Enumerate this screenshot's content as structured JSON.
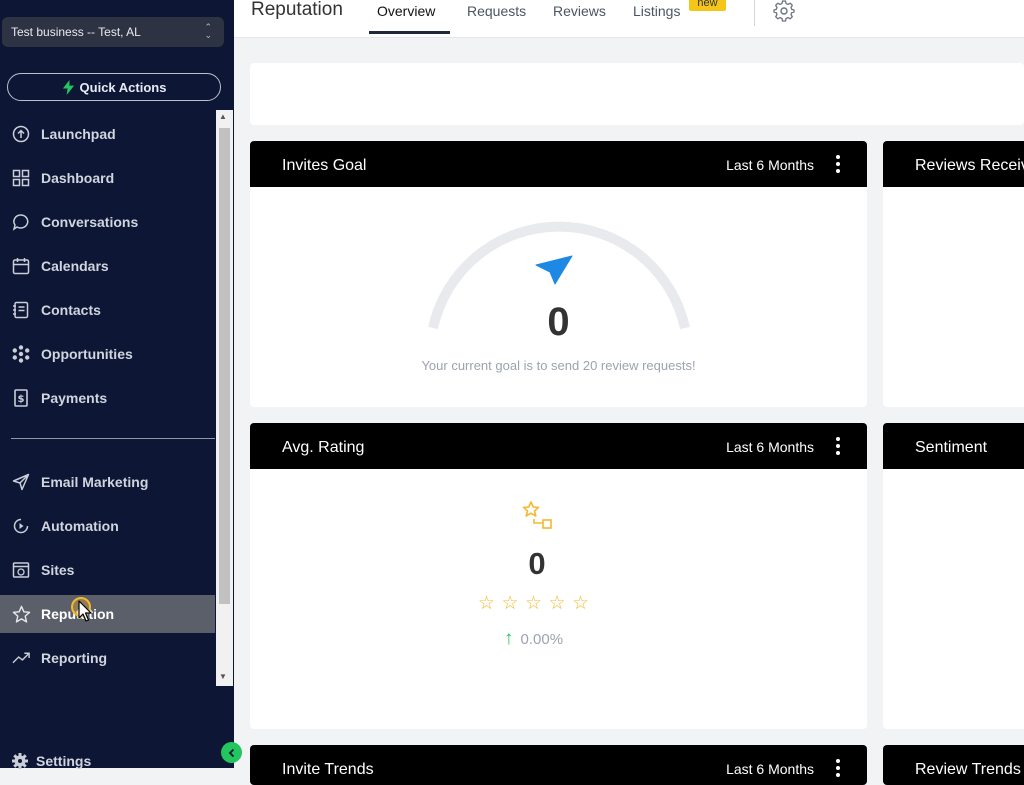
{
  "sidebar": {
    "location": "Test business -- Test, AL",
    "quick_actions": "Quick Actions",
    "items": [
      {
        "label": "Launchpad",
        "icon": "launchpad-icon"
      },
      {
        "label": "Dashboard",
        "icon": "dashboard-icon"
      },
      {
        "label": "Conversations",
        "icon": "chat-icon"
      },
      {
        "label": "Calendars",
        "icon": "calendar-icon"
      },
      {
        "label": "Contacts",
        "icon": "contacts-icon"
      },
      {
        "label": "Opportunities",
        "icon": "opportunities-icon"
      },
      {
        "label": "Payments",
        "icon": "payments-icon"
      },
      {
        "label": "Email Marketing",
        "icon": "send-icon"
      },
      {
        "label": "Automation",
        "icon": "automation-icon"
      },
      {
        "label": "Sites",
        "icon": "sites-icon"
      },
      {
        "label": "Reputation",
        "icon": "star-icon",
        "active": true
      },
      {
        "label": "Reporting",
        "icon": "reporting-icon"
      }
    ],
    "settings": "Settings"
  },
  "header": {
    "title": "Reputation",
    "tabs": [
      {
        "label": "Overview",
        "active": true
      },
      {
        "label": "Requests"
      },
      {
        "label": "Reviews"
      },
      {
        "label": "Listings",
        "badge": "new"
      }
    ]
  },
  "cards": {
    "invites_goal": {
      "title": "Invites Goal",
      "range": "Last 6 Months",
      "value": "0",
      "message": "Your current goal is to send 20 review requests!"
    },
    "reviews_received": {
      "title": "Reviews Received"
    },
    "avg_rating": {
      "title": "Avg. Rating",
      "range": "Last 6 Months",
      "value": "0",
      "change": "0.00%",
      "stars": 5
    },
    "sentiment": {
      "title": "Sentiment"
    },
    "invite_trends": {
      "title": "Invite Trends",
      "range": "Last 6 Months"
    },
    "review_trends": {
      "title": "Review Trends"
    }
  },
  "colors": {
    "sidebar_bg": "#0d1634",
    "active_item": "#5b5f6a",
    "accent_green": "#22c55e",
    "star": "#f5b82e",
    "send_blue": "#1e88e5",
    "badge": "#f5c518"
  }
}
